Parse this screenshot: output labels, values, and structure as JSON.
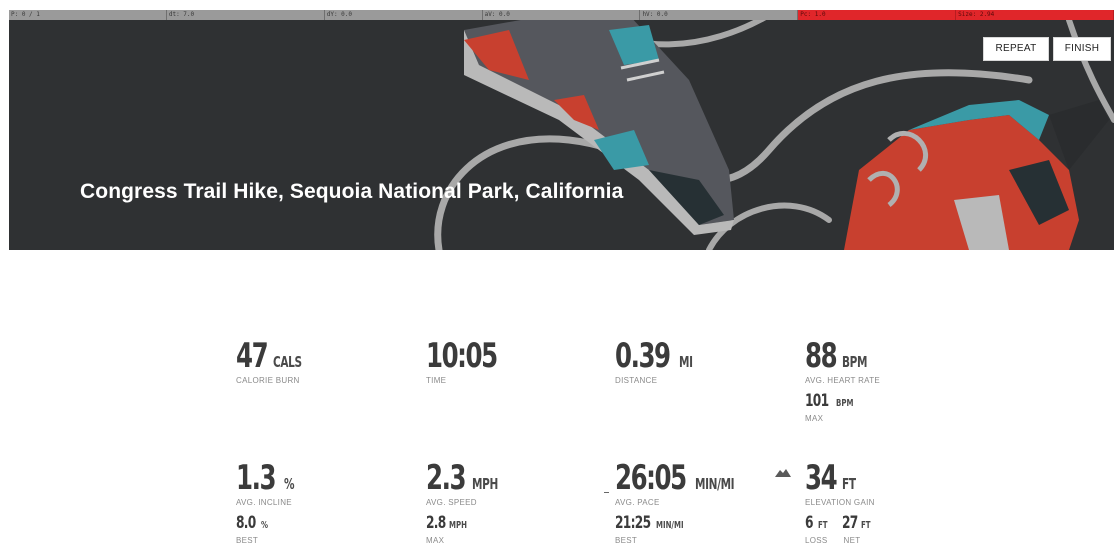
{
  "status_strip": {
    "cells": [
      {
        "text": "P: 0 / 1",
        "alert": false
      },
      {
        "text": "dt: 7.0",
        "alert": false
      },
      {
        "text": "dY: 0.0",
        "alert": false
      },
      {
        "text": "aV: 0.0",
        "alert": false
      },
      {
        "text": "hV: 0.0",
        "alert": false
      },
      {
        "text": "Pc: 1.0",
        "alert": true
      },
      {
        "text": "Size: 2.94",
        "alert": true
      }
    ]
  },
  "hero": {
    "title": "Congress Trail Hike, Sequoia National Park, California",
    "repeat_label": "REPEAT",
    "finish_label": "FINISH"
  },
  "stats": {
    "calories": {
      "value": "47",
      "unit": "CALS",
      "label": "CALORIE BURN"
    },
    "time": {
      "value": "10:05",
      "label": "TIME"
    },
    "distance": {
      "value": "0.39",
      "unit": "MI",
      "label": "DISTANCE"
    },
    "heart_rate": {
      "value": "88",
      "unit": "BPM",
      "label": "AVG. HEART RATE",
      "max_value": "101",
      "max_unit": "BPM",
      "max_label": "MAX"
    },
    "incline": {
      "value": "1.3",
      "unit": "%",
      "label": "AVG. INCLINE",
      "best_value": "8.0",
      "best_unit": "%",
      "best_label": "BEST"
    },
    "speed": {
      "value": "2.3",
      "unit": "MPH",
      "label": "AVG. SPEED",
      "max_value": "2.8",
      "max_unit": "MPH",
      "max_label": "MAX"
    },
    "pace": {
      "value": "26:05",
      "unit": "MIN/MI",
      "label": "AVG. PACE",
      "best_value": "21:25",
      "best_unit": "MIN/MI",
      "best_label": "BEST"
    },
    "elevation": {
      "value": "34",
      "unit": "FT",
      "label": "ELEVATION GAIN",
      "loss_value": "6",
      "loss_unit": "FT",
      "loss_label": "LOSS",
      "net_value": "27",
      "net_unit": "FT",
      "net_label": "NET"
    }
  },
  "icons": {
    "elevation": "mountain-icon"
  },
  "colors": {
    "hero_bg": "#2f3133",
    "shoe_red": "#c8402f",
    "shoe_teal": "#3a9aa6",
    "alert_red": "#e0262a"
  }
}
